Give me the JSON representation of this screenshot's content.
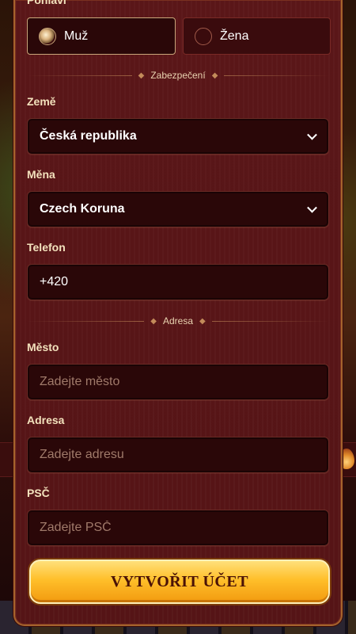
{
  "gender": {
    "label": "Pohlaví",
    "options": [
      {
        "label": "Muž",
        "selected": true
      },
      {
        "label": "Žena",
        "selected": false
      }
    ]
  },
  "sections": {
    "security": "Zabezpečení",
    "address": "Adresa"
  },
  "country": {
    "label": "Země",
    "value": "Česká republika"
  },
  "currency": {
    "label": "Měna",
    "value": "Czech Koruna"
  },
  "phone": {
    "label": "Telefon",
    "value": "+420"
  },
  "city": {
    "label": "Město",
    "placeholder": "Zadejte město"
  },
  "address": {
    "label": "Adresa",
    "placeholder": "Zadejte adresu"
  },
  "zip": {
    "label": "PSČ",
    "placeholder": "Zadejte PSČ"
  },
  "submit": {
    "label": "VYTVOŘIT ÚČET"
  },
  "colors": {
    "panel": "#5a1618",
    "field": "#2a0708",
    "border_gold": "#a5632c",
    "cta": "#ffbf2a",
    "cta_text": "#4a1206"
  },
  "icons": {
    "select": "chevron-down-icon",
    "radio_on": "radio-selected-icon",
    "radio_off": "radio-unselected-icon"
  }
}
